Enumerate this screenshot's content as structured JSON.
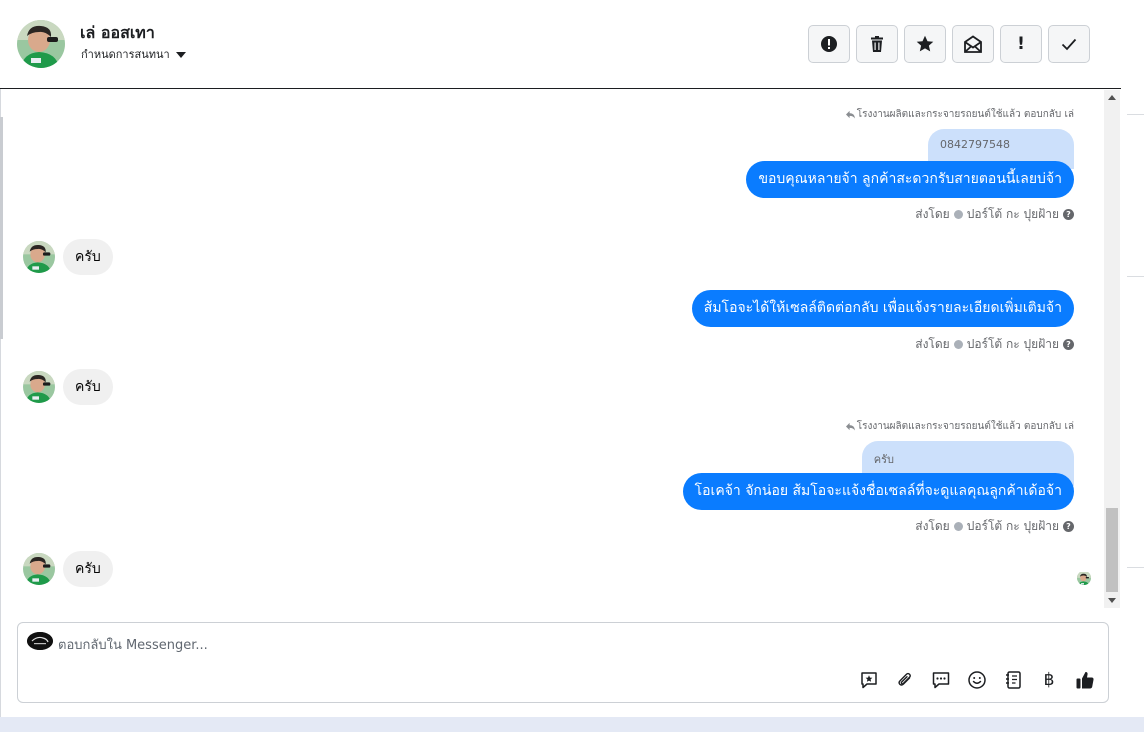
{
  "header": {
    "contact_name": "เล่ ออสเทา",
    "assign_label": "กำหนดการสนทนา",
    "actions": [
      {
        "name": "mark-spam-button",
        "icon": "alert-circle-icon"
      },
      {
        "name": "delete-button",
        "icon": "trash-icon"
      },
      {
        "name": "star-button",
        "icon": "star-icon"
      },
      {
        "name": "mark-unread-button",
        "icon": "envelope-icon"
      },
      {
        "name": "important-button",
        "icon": "exclamation-icon"
      },
      {
        "name": "mark-done-button",
        "icon": "check-icon"
      }
    ]
  },
  "messages": {
    "reply_context_1": "โรงงานผลิตและกระจายรถยนต์ใช้แล้ว ตอบกลับ เล่",
    "quoted_1": "0842797548",
    "out_1": "ขอบคุณหลายจ้า  ลูกค้าสะดวกรับสายตอนนี้เลยบ่จ้า",
    "sent_by_prefix": "ส่งโดย",
    "sent_by_name": "ปอร์โต้ กะ ปุยฝ้าย",
    "in_1": "ครับ",
    "out_2": "ส้มโอจะได้ให้เซลล์ติดต่อกลับ เพื่อแจ้งรายละเอียดเพิ่มเติมจ้า",
    "in_2": "ครับ",
    "reply_context_2": "โรงงานผลิตและกระจายรถยนต์ใช้แล้ว ตอบกลับ เล่",
    "quoted_2": "ครับ",
    "out_3": "โอเคจ้า จักน่อย ส้มโอจะแจ้งชื่อเซลล์ที่จะดูแลคุณลูกค้าเด้อจ้า",
    "in_3": "ครับ"
  },
  "composer": {
    "placeholder": "ตอบกลับใน Messenger...",
    "tools": [
      {
        "name": "saved-reply-button",
        "icon": "saved-reply-icon"
      },
      {
        "name": "attach-button",
        "icon": "paperclip-icon"
      },
      {
        "name": "quick-reply-button",
        "icon": "chat-bubble-icon"
      },
      {
        "name": "emoji-button",
        "icon": "smiley-icon"
      },
      {
        "name": "note-button",
        "icon": "notebook-icon"
      },
      {
        "name": "payment-button",
        "icon": "baht-icon",
        "glyph": "฿"
      },
      {
        "name": "like-button",
        "icon": "thumbs-up-icon"
      }
    ]
  },
  "colors": {
    "outgoing_bubble": "#0a7cff",
    "quoted_bubble": "#cce0fb",
    "incoming_bubble": "#f0f0f0",
    "background": "#e4e9f5"
  }
}
